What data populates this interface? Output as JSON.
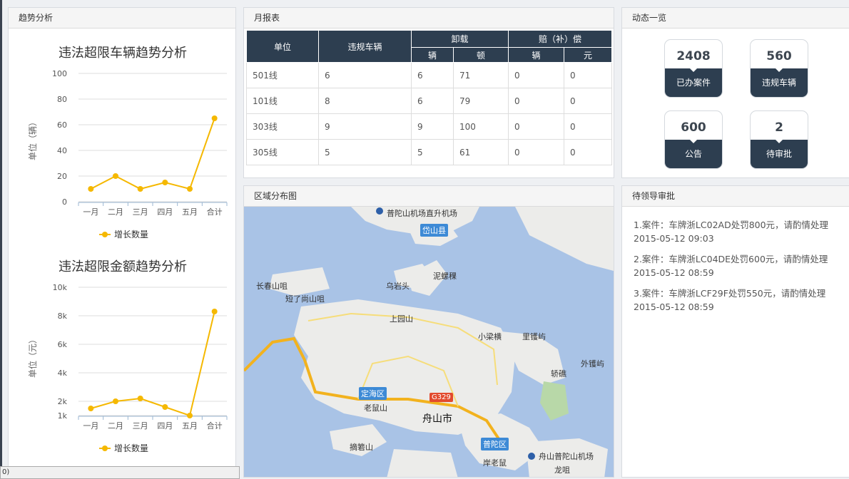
{
  "colors": {
    "accent": "#f5b800",
    "header_dark": "#2d3e50",
    "map_water": "#a9c3e6",
    "map_land": "#ececea"
  },
  "trend": {
    "title": "趋势分析",
    "chart1": {
      "title": "违法超限车辆趋势分析",
      "ylabel": "单位（辆）",
      "legend": "增长数量"
    },
    "chart2": {
      "title": "违法超限金额趋势分析",
      "ylabel": "单位（元）",
      "legend": "增长数量"
    }
  },
  "chart_data": [
    {
      "type": "line",
      "title": "违法超限车辆趋势分析",
      "ylabel": "单位（辆）",
      "xlabel": "",
      "categories": [
        "一月",
        "二月",
        "三月",
        "四月",
        "五月",
        "合计"
      ],
      "series": [
        {
          "name": "增长数量",
          "values": [
            10,
            20,
            10,
            15,
            10,
            65
          ]
        }
      ],
      "ylim": [
        0,
        100
      ],
      "yticks": [
        "0",
        "20",
        "40",
        "60",
        "80",
        "100"
      ],
      "grid": true,
      "legend": "bottom"
    },
    {
      "type": "line",
      "title": "违法超限金额趋势分析",
      "ylabel": "单位（元）",
      "xlabel": "",
      "categories": [
        "一月",
        "二月",
        "三月",
        "四月",
        "五月",
        "合计"
      ],
      "series": [
        {
          "name": "增长数量",
          "values": [
            1500,
            2000,
            2200,
            1600,
            1000,
            8300
          ]
        }
      ],
      "ylim": [
        1000,
        10000
      ],
      "yticks": [
        "1k",
        "2k",
        "4k",
        "6k",
        "8k",
        "10k"
      ],
      "grid": true,
      "legend": "bottom"
    }
  ],
  "report": {
    "title": "月报表",
    "headers": {
      "unit": "单位",
      "vehicles": "违规车辆",
      "unload": "卸载",
      "compensation": "赔（补）偿",
      "unload_vehicles": "辆",
      "unload_tons": "顿",
      "comp_vehicles": "辆",
      "comp_yuan": "元"
    },
    "rows": [
      [
        "501线",
        "6",
        "6",
        "71",
        "0",
        "0"
      ],
      [
        "101线",
        "8",
        "6",
        "79",
        "0",
        "0"
      ],
      [
        "303线",
        "9",
        "9",
        "100",
        "0",
        "0"
      ],
      [
        "305线",
        "5",
        "5",
        "61",
        "0",
        "0"
      ]
    ]
  },
  "dynamic": {
    "title": "动态一览",
    "cards": [
      {
        "value": "2408",
        "label": "已办案件"
      },
      {
        "value": "560",
        "label": "违规车辆"
      },
      {
        "value": "600",
        "label": "公告"
      },
      {
        "value": "2",
        "label": "待审批"
      }
    ]
  },
  "region": {
    "title": "区域分布图",
    "labels": {
      "airport_top": "普陀山机场直升机场",
      "daishan": "岱山县",
      "luoluo": "泥螺稞",
      "wuyan": "乌岩头",
      "changchun": "长春山咀",
      "duanding": "短了尚山咀",
      "shangyuan": "上园山",
      "xiaoliang": "小梁横",
      "lixiang": "里镬屿",
      "waixiang": "外镬屿",
      "qiaopu": "轿礁",
      "dinghai": "定海区",
      "laoshu": "老鼠山",
      "g329": "G329",
      "zhoushan": "舟山市",
      "zhuzhi": "摘箬山",
      "putuo": "普陀区",
      "anlao": "岸老鼠",
      "psairport": "舟山普陀山机场",
      "longzui": "龙咀"
    }
  },
  "pending": {
    "title": "待领导审批",
    "items": [
      {
        "text": "1.案件：车牌浙LC02AD处罚800元，请酌情处理",
        "time": "2015-05-12 09:03"
      },
      {
        "text": "2.案件：车牌浙LC04DE处罚600元，请酌情处理",
        "time": "2015-05-12 08:59"
      },
      {
        "text": "3.案件：车牌浙LCF29F处罚550元，请酌情处理",
        "time": "2015-05-12 08:59"
      }
    ]
  },
  "statusbar": {
    "text": "0)"
  }
}
